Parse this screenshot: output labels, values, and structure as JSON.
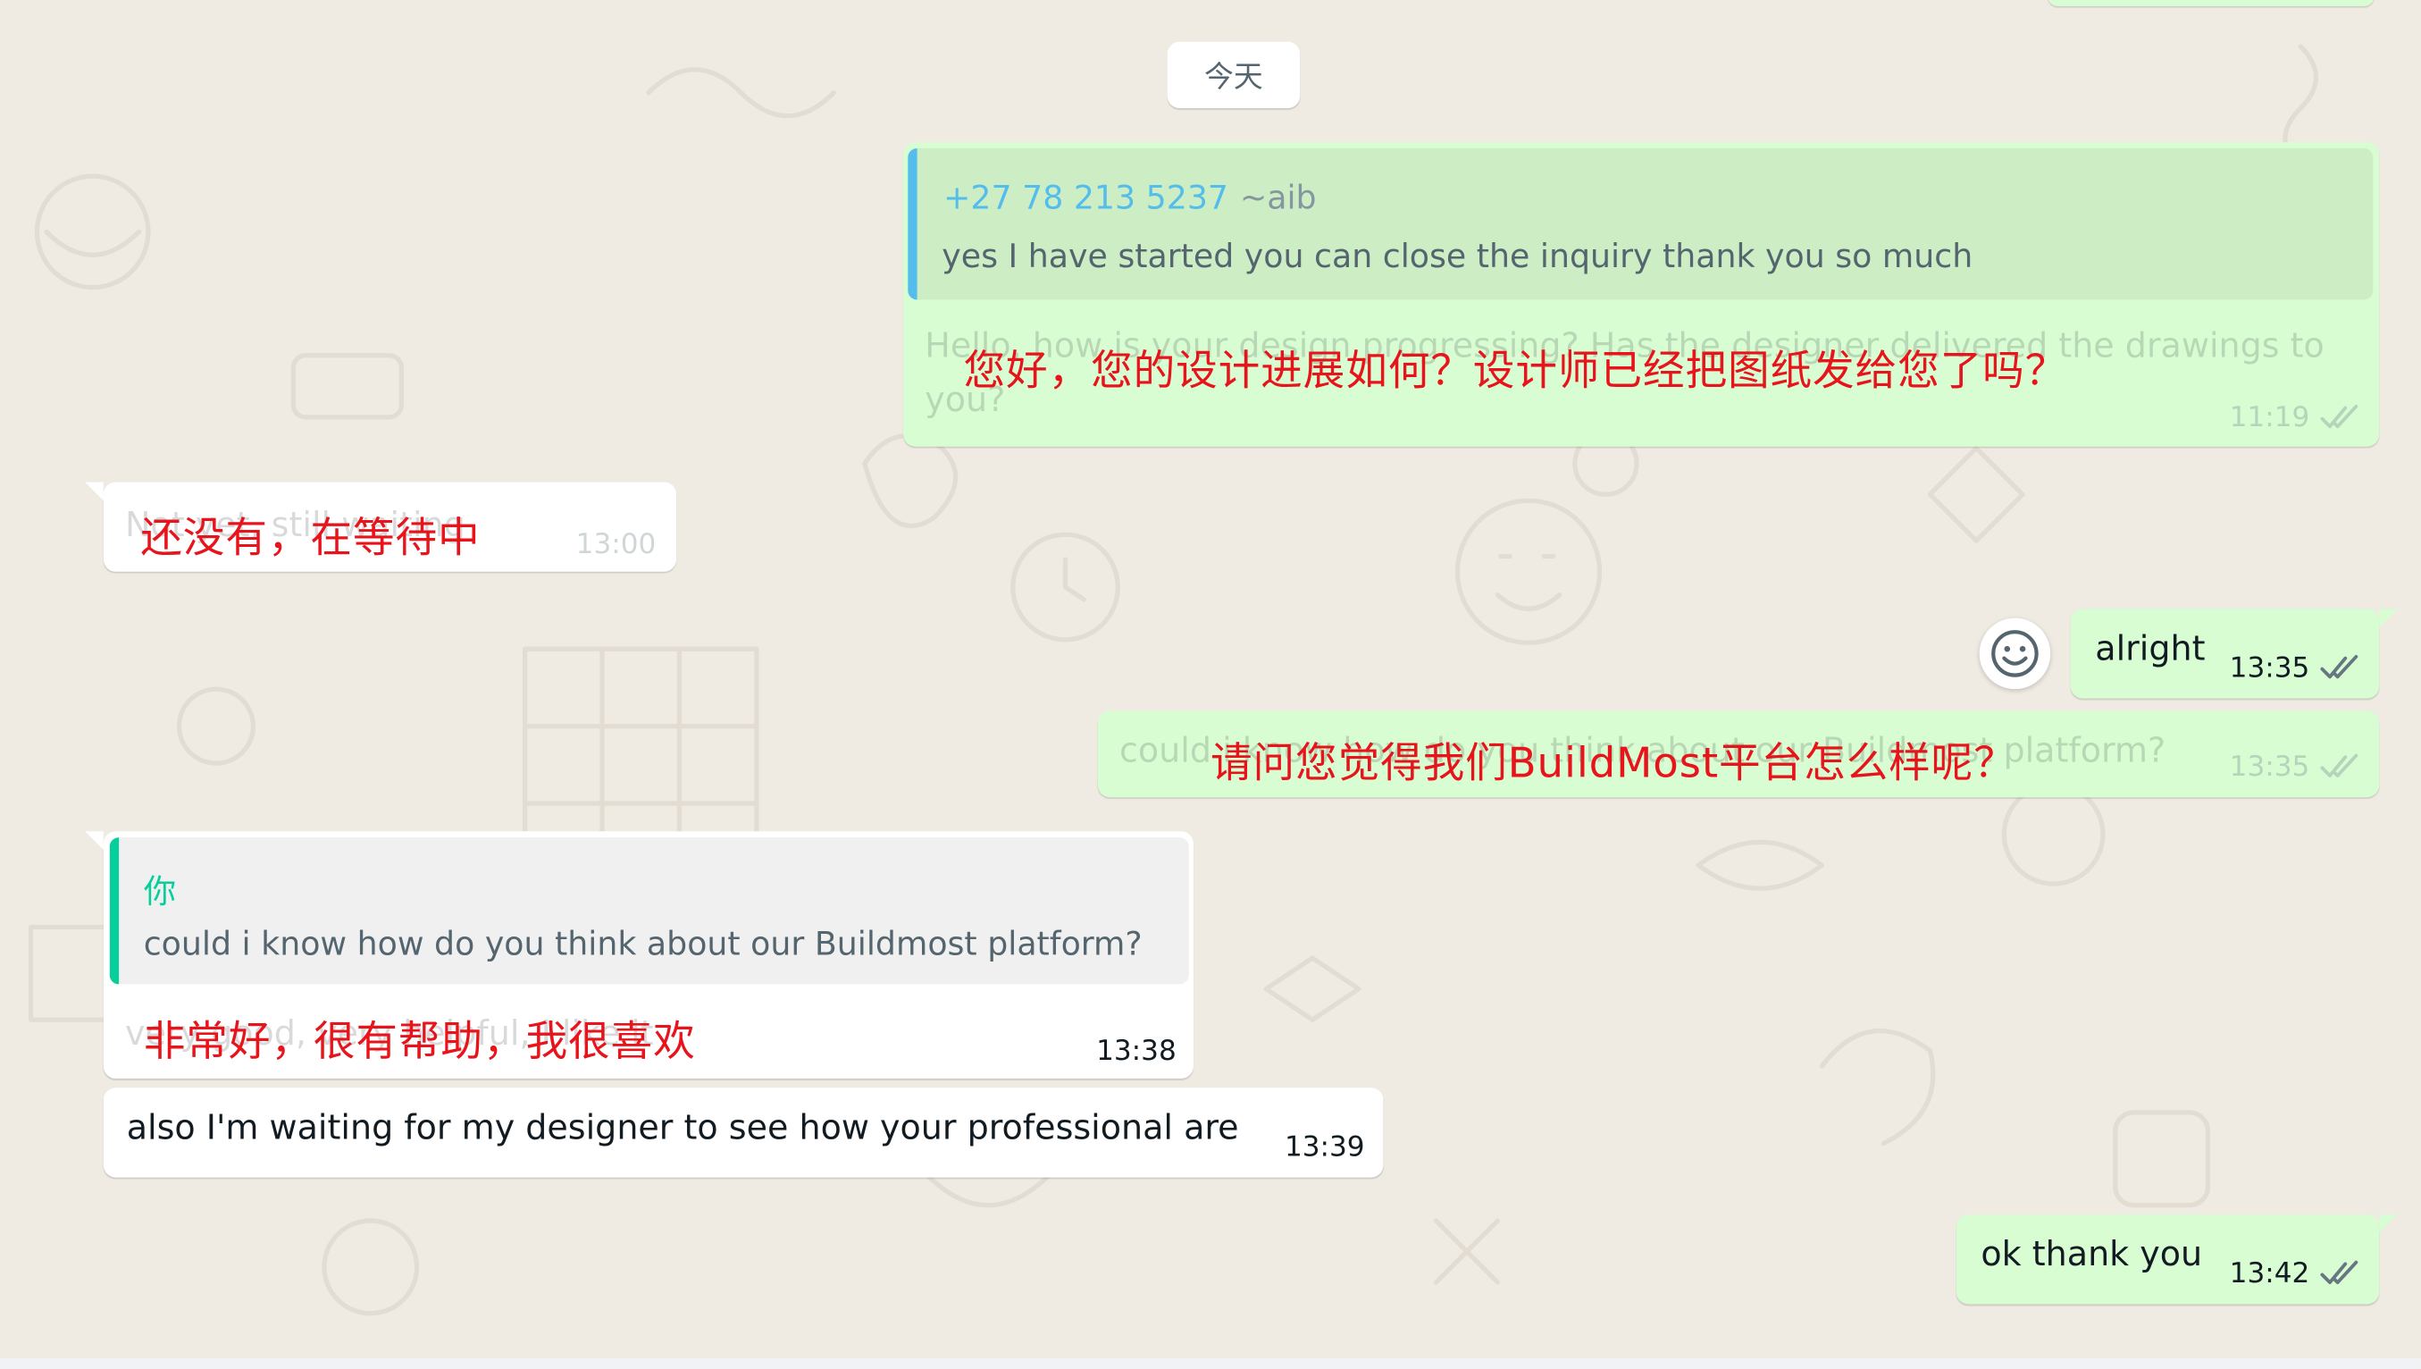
{
  "chat": {
    "date_label": "今天",
    "messages": [
      {
        "id": "m1",
        "direction": "outgoing",
        "quote_author": "+27 78 213 5237",
        "quote_author_name": "~aib",
        "quote_text": "yes I have started you can close the inquiry thank you so much",
        "text_line1": "Hello, how is your design progressing? Has the designer delivered the drawings to",
        "text_line2": "you?",
        "translation": "您好，您的设计进展如何？设计师已经把图纸发给您了吗？",
        "time": "11:19",
        "status": "read"
      },
      {
        "id": "m2",
        "direction": "incoming",
        "text": "Not yet, still waiting",
        "translation": "还没有，在等待中",
        "time": "13:00"
      },
      {
        "id": "m3",
        "direction": "outgoing",
        "text": "alright",
        "time": "13:35",
        "status": "read"
      },
      {
        "id": "m4",
        "direction": "outgoing",
        "text": "could i know how do you think about our Buildmost platform?",
        "translation": "请问您觉得我们BuildMost平台怎么样呢？",
        "time": "13:35",
        "status": "read"
      },
      {
        "id": "m5",
        "direction": "incoming",
        "quote_author": "你",
        "quote_text": "could i know how do you think about our Buildmost platform?",
        "text": "very good, very helpful, I like it",
        "translation": "非常好，很有帮助，我很喜欢",
        "time": "13:38"
      },
      {
        "id": "m6",
        "direction": "incoming",
        "text": "also I'm waiting for my designer to see how your professional are",
        "time": "13:39"
      },
      {
        "id": "m7",
        "direction": "outgoing",
        "text": "ok thank you",
        "time": "13:42",
        "status": "read"
      }
    ]
  },
  "colors": {
    "background": "#efeae2",
    "outgoing_bubble": "#d9fdd3",
    "incoming_bubble": "#ffffff",
    "quote_author_outgoing": "#53bdeb",
    "quote_author_incoming": "#06cf9c",
    "tick_read": "#667781",
    "translation_overlay": "#e8141c"
  },
  "icons": {
    "emoji_reaction": "smiley-face-icon",
    "read_receipt": "double-check-icon"
  }
}
